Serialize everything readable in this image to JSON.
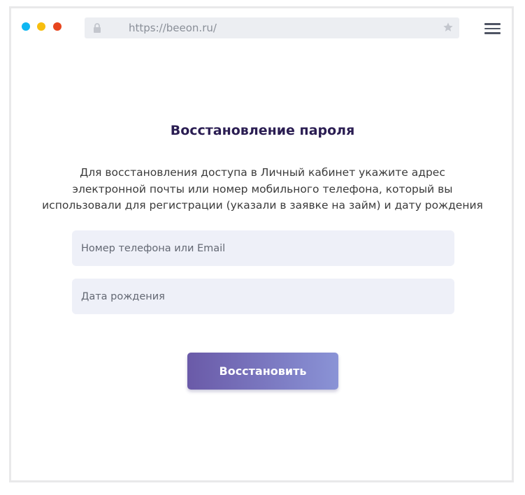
{
  "browser": {
    "url": "https://beeon.ru/",
    "icons": [
      "lock-icon",
      "star-icon",
      "menu-icon"
    ],
    "dot_colors": [
      "#10b7f2",
      "#f7be0e",
      "#e7451e"
    ]
  },
  "page": {
    "title": "Восстановление пароля",
    "description": "Для восстановления доступа в Личный кабинет укажите адрес электронной почты или номер мобильного телефона, который вы использовали для регистрации (указали в заявке на займ) и дату рождения",
    "phone_placeholder": "Номер телефона или Email",
    "birthdate_placeholder": "Дата рождения",
    "submit_label": "Восстановить"
  },
  "colors": {
    "title": "#2a1d52",
    "field_bg": "#eef0f8",
    "button_gradient_start": "#6a5aa8",
    "button_gradient_end": "#8a93d6"
  }
}
